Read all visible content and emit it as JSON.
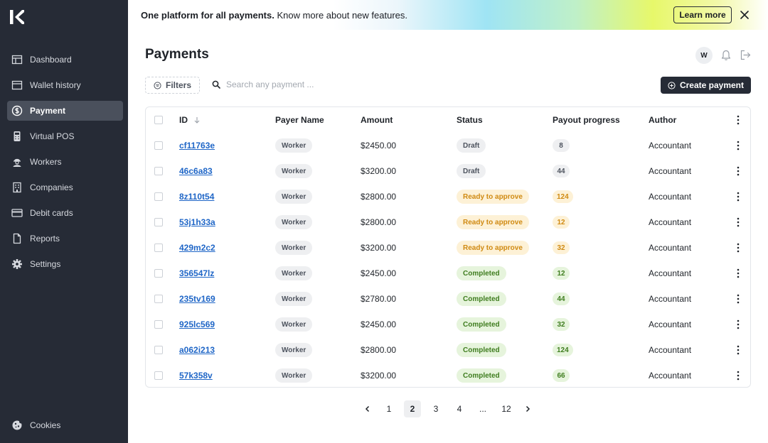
{
  "banner": {
    "headline": "One platform for all payments.",
    "subtext": " Know more about new features.",
    "learn_more": "Learn more"
  },
  "sidebar": {
    "items": [
      {
        "label": "Dashboard",
        "icon": "dashboard-icon"
      },
      {
        "label": "Wallet history",
        "icon": "wallet-icon"
      },
      {
        "label": "Payment",
        "icon": "dollar-icon",
        "active": true
      },
      {
        "label": "Virtual POS",
        "icon": "pos-icon"
      },
      {
        "label": "Workers",
        "icon": "worker-icon"
      },
      {
        "label": "Companies",
        "icon": "building-icon"
      },
      {
        "label": "Debit cards",
        "icon": "card-icon"
      },
      {
        "label": "Reports",
        "icon": "document-icon"
      },
      {
        "label": "Settings",
        "icon": "gear-icon"
      }
    ],
    "cookies": "Cookies"
  },
  "header": {
    "title": "Payments",
    "avatar": "W"
  },
  "toolbar": {
    "filters": "Filters",
    "search_placeholder": "Search any payment ...",
    "create": "Create payment"
  },
  "table": {
    "columns": {
      "id": "ID",
      "payer": "Payer Name",
      "amount": "Amount",
      "status": "Status",
      "progress": "Payout progress",
      "author": "Author"
    },
    "rows": [
      {
        "id": "cf11763e",
        "payer": "Worker",
        "amount": "$2450.00",
        "status": "Draft",
        "progress": "8",
        "author": "Accountant"
      },
      {
        "id": "46c6a83",
        "payer": "Worker",
        "amount": "$3200.00",
        "status": "Draft",
        "progress": "44",
        "author": "Accountant"
      },
      {
        "id": "8z110t54",
        "payer": "Worker",
        "amount": "$2800.00",
        "status": "Ready to approve",
        "progress": "124",
        "author": "Accountant"
      },
      {
        "id": "53j1h33a",
        "payer": "Worker",
        "amount": "$2800.00",
        "status": "Ready to approve",
        "progress": "12",
        "author": "Accountant"
      },
      {
        "id": "429m2c2",
        "payer": "Worker",
        "amount": "$3200.00",
        "status": "Ready to approve",
        "progress": "32",
        "author": "Accountant"
      },
      {
        "id": "356547lz",
        "payer": "Worker",
        "amount": "$2450.00",
        "status": "Completed",
        "progress": "12",
        "author": "Accountant"
      },
      {
        "id": "235tv169",
        "payer": "Worker",
        "amount": "$2780.00",
        "status": "Completed",
        "progress": "44",
        "author": "Accountant"
      },
      {
        "id": "925lc569",
        "payer": "Worker",
        "amount": "$2450.00",
        "status": "Completed",
        "progress": "32",
        "author": "Accountant"
      },
      {
        "id": "a062i213",
        "payer": "Worker",
        "amount": "$2800.00",
        "status": "Completed",
        "progress": "124",
        "author": "Accountant"
      },
      {
        "id": "57k358v",
        "payer": "Worker",
        "amount": "$3200.00",
        "status": "Completed",
        "progress": "66",
        "author": "Accountant"
      }
    ]
  },
  "pagination": {
    "pages": [
      "1",
      "2",
      "3",
      "4",
      "...",
      "12"
    ],
    "current": "2"
  },
  "colors": {
    "sidebar_bg": "#262b36",
    "link": "#1f66c7",
    "status_draft": "#eeeff1",
    "status_ready": "#fdf1d6",
    "status_completed": "#e6f4dc"
  }
}
